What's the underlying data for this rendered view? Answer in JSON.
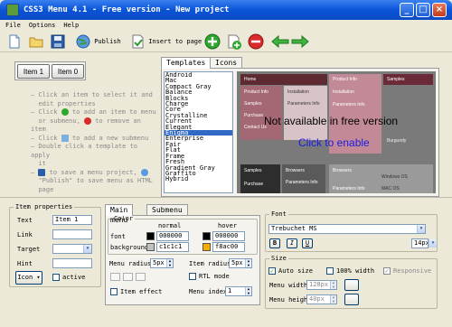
{
  "window": {
    "title": "CSS3 Menu 4.1 - Free version - New project"
  },
  "menubar": {
    "items": [
      "File",
      "Options",
      "Help"
    ]
  },
  "toolbar": {
    "publish_label": "Publish",
    "insert_label": "Insert to page"
  },
  "items": [
    {
      "label": "Item 1"
    },
    {
      "label": "Item 0"
    }
  ],
  "help": {
    "line1": "Click an item to select it and",
    "line2": "edit properties",
    "line3a": "Click",
    "line3b": "to add an item to menu",
    "line4a": "or submenu,",
    "line4b": "to remove an item",
    "line5a": "Click",
    "line5b": "to add a new submenu",
    "line6": "Double click a template to apply",
    "line7": "it",
    "line8": "to save a menu project,",
    "line9a": "\"Publish\"",
    "line9b": "to save menu as HTML",
    "line10": "page"
  },
  "template_tabs": {
    "templates": "Templates",
    "icons": "Icons"
  },
  "templates": [
    "Android",
    "Mac",
    "Compact Gray",
    "Balance",
    "Blocks",
    "Charge",
    "Core",
    "Crystalline",
    "Current",
    "Elegant",
    "Enigma",
    "Enterprise",
    "Fair",
    "Flat",
    "Frame",
    "Fresh",
    "Gradient Gray",
    "Graffito",
    "Hybrid"
  ],
  "selected_template": "Enigma",
  "preview": {
    "not_available": "Not available in free version",
    "click_enable": "Click to enable",
    "labels": {
      "home": "Home",
      "product_info": "Product Info",
      "installation": "Installation",
      "samples": "Samples",
      "purchase": "Purchase",
      "contact_us": "Contact Us",
      "parameters_info": "Parameters Info",
      "burgundy": "Burgundy",
      "browsers": "Browsers",
      "windows_os": "Windows OS",
      "mac_os": "MAC OS"
    }
  },
  "item_properties": {
    "legend": "Item properties",
    "text_label": "Text",
    "text_value": "Item 1",
    "link_label": "Link",
    "link_value": "",
    "target_label": "Target",
    "target_value": "",
    "hint_label": "Hint",
    "hint_value": "",
    "icon_button": "Icon",
    "active_label": "active"
  },
  "bottom_tabs": {
    "main_menu": "Main menu",
    "submenu": "Submenu"
  },
  "color": {
    "legend": "Color",
    "normal": "normal",
    "hover": "hover",
    "font_label": "font",
    "background_label": "background",
    "font_normal": "000000",
    "font_hover": "000000",
    "bg_normal": "c1c1c1",
    "bg_hover": "f8ac00",
    "font_normal_color": "#000000",
    "font_hover_color": "#000000",
    "bg_normal_color": "#c1c1c1",
    "bg_hover_color": "#f8ac00"
  },
  "menu_radius": {
    "label": "Menu radius",
    "value": "5px"
  },
  "item_radius": {
    "label": "Item radius",
    "value": "5px"
  },
  "rtl_mode": "RTL mode",
  "item_effect": "Item effect",
  "menu_index": {
    "label": "Menu index",
    "value": "1"
  },
  "font": {
    "legend": "Font",
    "family": "Trebuchet MS",
    "bold": "B",
    "italic": "I",
    "underline": "U",
    "size": "14px"
  },
  "size": {
    "legend": "Size",
    "auto_size": "Auto size",
    "full_width": "100% width",
    "responsive": "Responsive",
    "menu_width_label": "Menu width",
    "menu_width_value": "128px",
    "menu_height_label": "Menu height",
    "menu_height_value": "40px"
  }
}
